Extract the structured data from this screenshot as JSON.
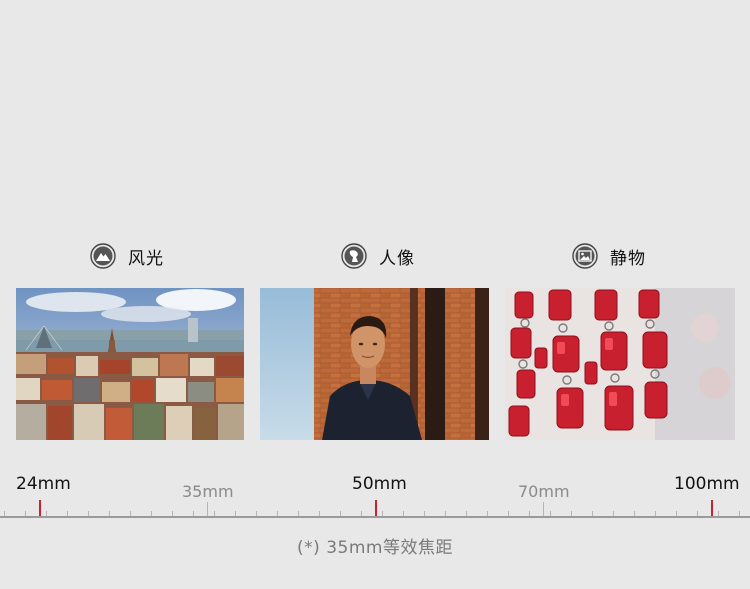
{
  "categories": [
    {
      "label": "风光",
      "icon": "mountain-icon"
    },
    {
      "label": "人像",
      "icon": "portrait-icon"
    },
    {
      "label": "静物",
      "icon": "still-life-icon"
    }
  ],
  "photos": [
    {
      "subject": "city-landscape"
    },
    {
      "subject": "man-portrait"
    },
    {
      "subject": "red-crystals"
    }
  ],
  "focal_lengths": [
    {
      "label": "24mm",
      "emphasis": "major"
    },
    {
      "label": "35mm",
      "emphasis": "minor"
    },
    {
      "label": "50mm",
      "emphasis": "major"
    },
    {
      "label": "70mm",
      "emphasis": "minor"
    },
    {
      "label": "100mm",
      "emphasis": "major"
    }
  ],
  "footnote": "(*) 35mm等效焦距",
  "colors": {
    "background": "#e8e8e8",
    "marker": "#d0202a",
    "ruler": "#9a9a9a"
  }
}
